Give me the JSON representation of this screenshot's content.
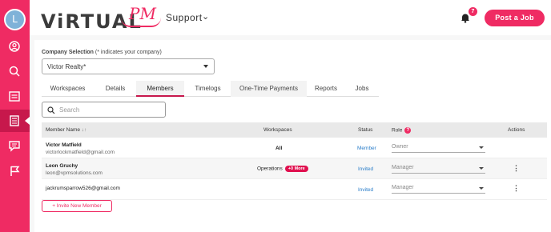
{
  "sidebar": {
    "avatar_initial": "L",
    "items": [
      {
        "icon": "user-circle-icon"
      },
      {
        "icon": "search-icon"
      },
      {
        "icon": "briefcase-list-icon"
      },
      {
        "icon": "calculator-icon"
      },
      {
        "icon": "chat-icon"
      },
      {
        "icon": "flag-icon"
      }
    ],
    "accent": "#ef2b63"
  },
  "header": {
    "logo_main": "ViRTUAL",
    "logo_pm": "PM",
    "support_label": "Support",
    "notification_count": "7",
    "post_job_label": "Post a Job"
  },
  "company": {
    "label": "Company Selection",
    "label_note": "(* indicates your company)",
    "selected": "Victor Realty*"
  },
  "tabs": [
    {
      "label": "Workspaces"
    },
    {
      "label": "Details"
    },
    {
      "label": "Members",
      "active": true
    },
    {
      "label": "Timelogs"
    },
    {
      "label": "One-Time Payments"
    },
    {
      "label": "Reports"
    },
    {
      "label": "Jobs"
    }
  ],
  "search": {
    "placeholder": "Search"
  },
  "table": {
    "headers": {
      "member_name": "Member Name",
      "sort": "↓↑",
      "workspaces": "Workspaces",
      "status": "Status",
      "role": "Role",
      "actions": "Actions"
    },
    "rows": [
      {
        "name": "Victor Matfield",
        "email": "victorlockmatfield@gmail.com",
        "workspaces": "All",
        "more": "",
        "status": "Member",
        "role": "Owner",
        "has_actions": false
      },
      {
        "name": "Leon Gruchy",
        "email": "leon@vpmsolutions.com",
        "workspaces": "Operations",
        "more": "+0 More",
        "status": "Invited",
        "role": "Manager",
        "has_actions": true
      },
      {
        "name": "",
        "email": "jackrumsparrow526@gmail.com",
        "workspaces": "",
        "more": "",
        "status": "Invited",
        "role": "Manager",
        "has_actions": true
      }
    ]
  },
  "invite_button": "+ Invite New Member",
  "colors": {
    "accent": "#ef2b63",
    "status_link": "#2b7ec9"
  }
}
